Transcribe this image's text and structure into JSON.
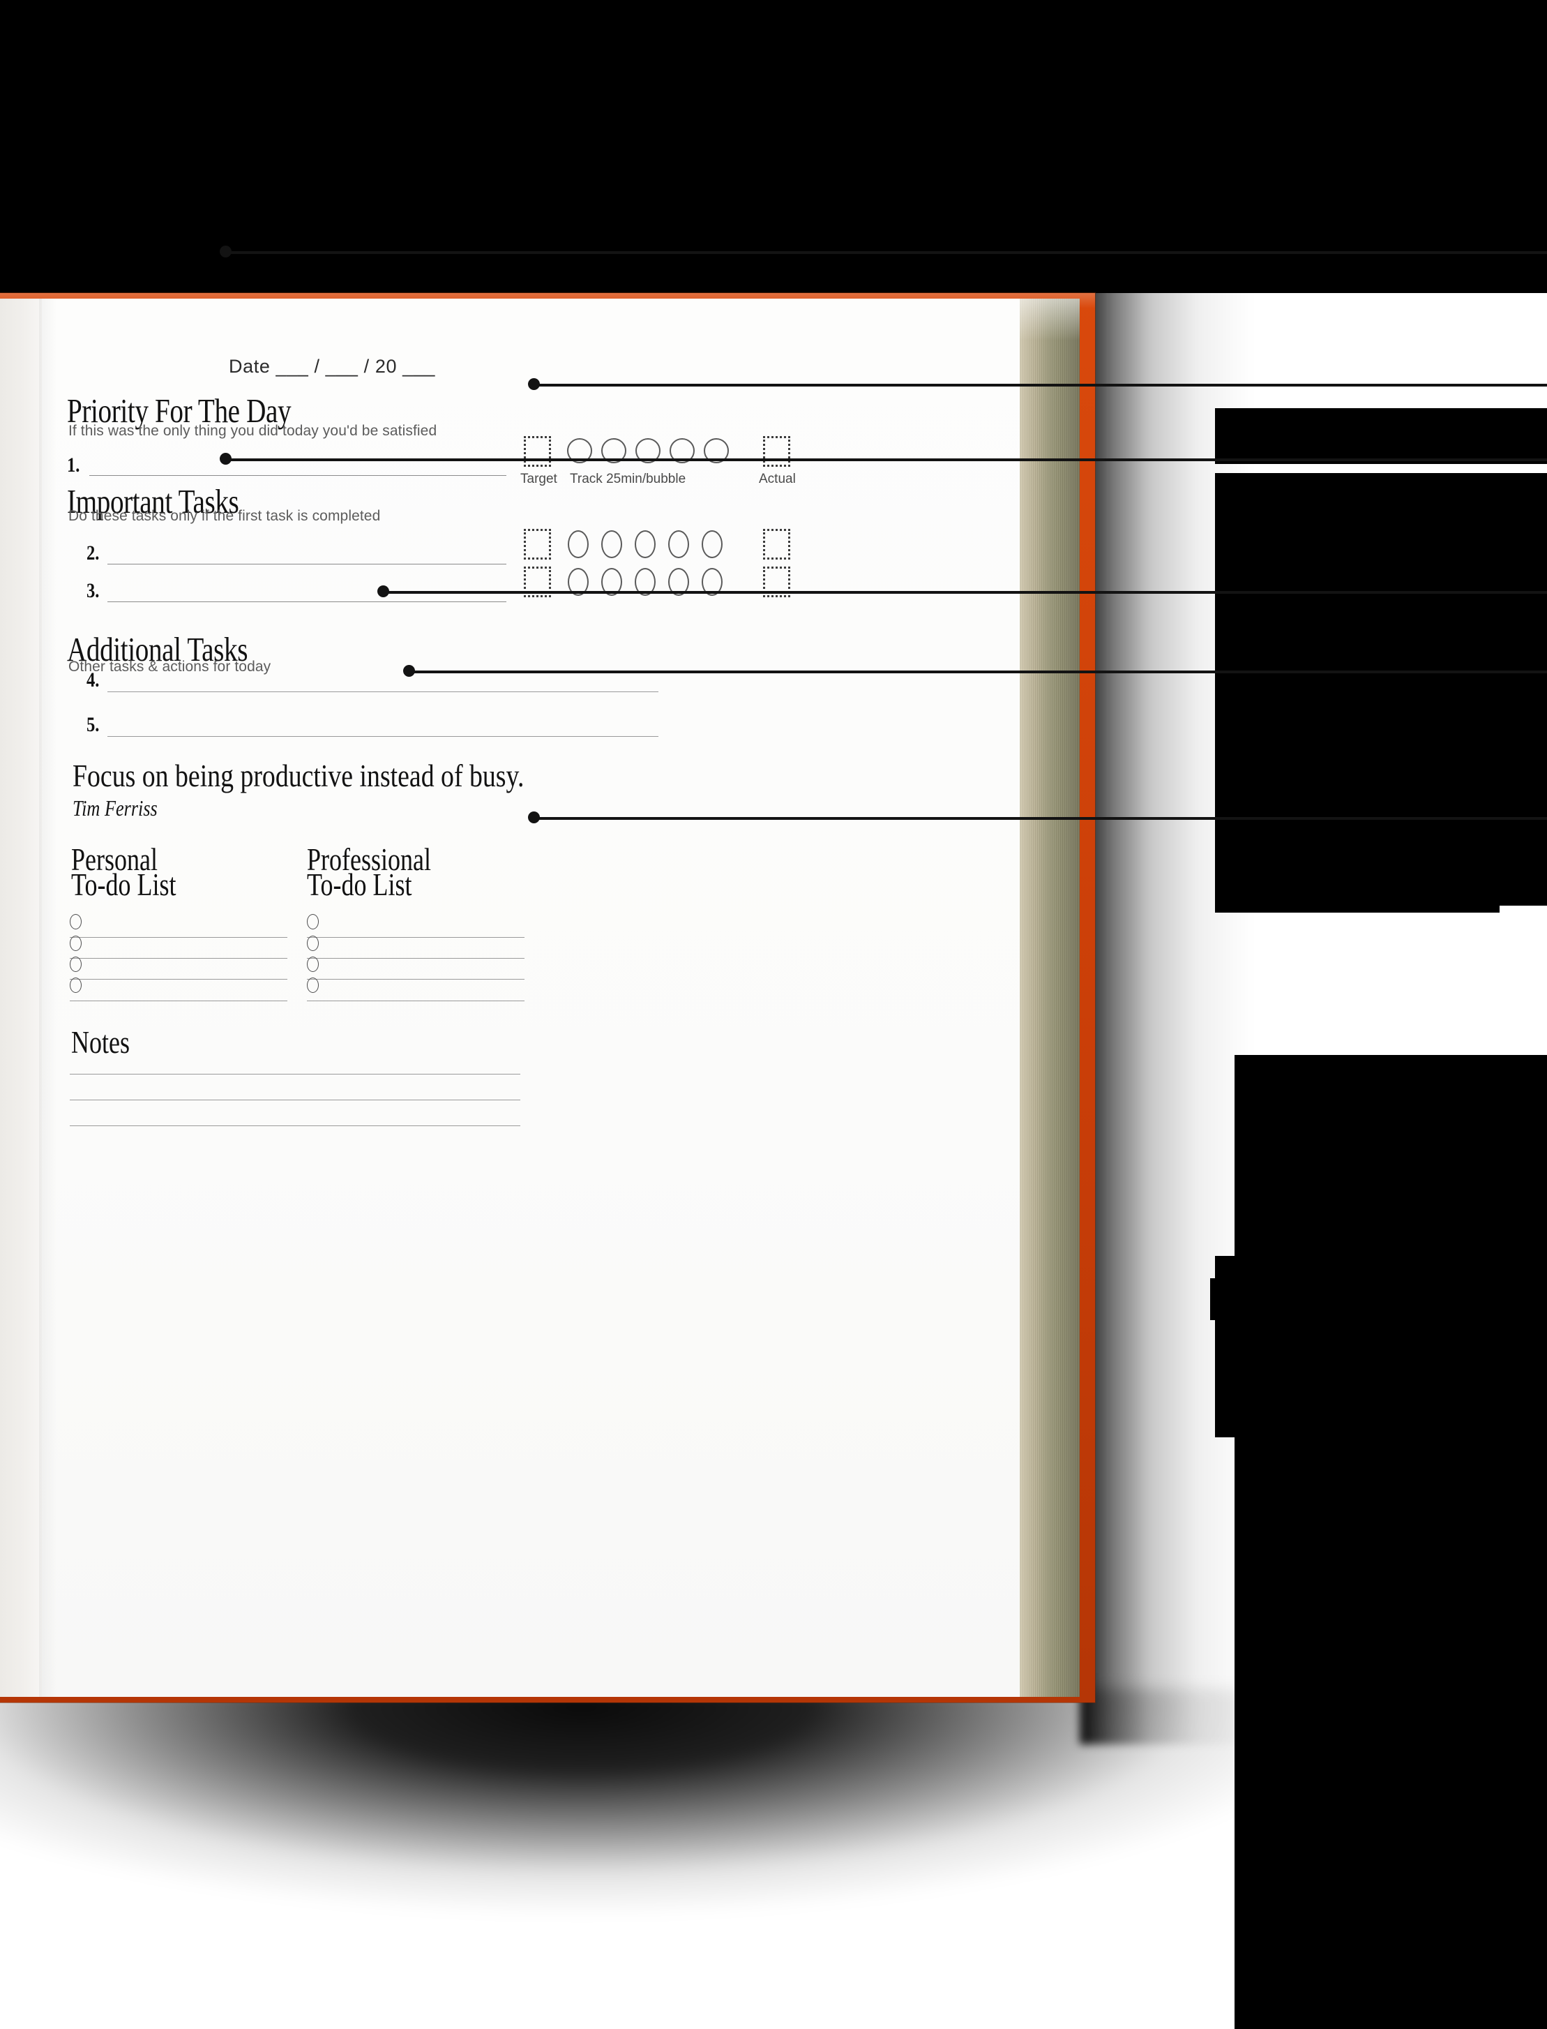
{
  "document": {
    "type": "daily-planner-page",
    "date_line": "Date ___ / ___ / 20 ___"
  },
  "colors": {
    "cover": "#c93e08",
    "page_edge_light": "#cdc5ab",
    "page_edge_dark": "#8c8a6d",
    "page": "#fbfbfa",
    "ink": "#131313",
    "rule": "#8b8b8b",
    "subtext": "#5c5c5c",
    "redaction": "#000000"
  },
  "sections": {
    "priority": {
      "title": "Priority For The Day",
      "subtitle": "If this was the only thing you did today you'd be satisfied",
      "rows": [
        {
          "number": "1."
        }
      ]
    },
    "important": {
      "title": "Important Tasks",
      "subtitle": "Do these tasks only if the first task is completed",
      "rows": [
        {
          "number": "2."
        },
        {
          "number": "3."
        }
      ]
    },
    "additional": {
      "title": "Additional Tasks",
      "subtitle": "Other tasks & actions for today",
      "rows": [
        {
          "number": "4."
        },
        {
          "number": "5."
        }
      ]
    },
    "notes": {
      "title": "Notes",
      "line_count": 3
    }
  },
  "tracker": {
    "target_label": "Target",
    "track_label": "Track 25min/bubble",
    "actual_label": "Actual",
    "bubble_count": 5
  },
  "quote": {
    "text": "Focus on being productive instead of busy.",
    "author": "Tim Ferriss"
  },
  "todo": {
    "personal": {
      "line1": "Personal",
      "line2": "To-do List",
      "item_count": 4
    },
    "professional": {
      "line1": "Professional",
      "line2": "To-do List",
      "item_count": 4
    }
  }
}
